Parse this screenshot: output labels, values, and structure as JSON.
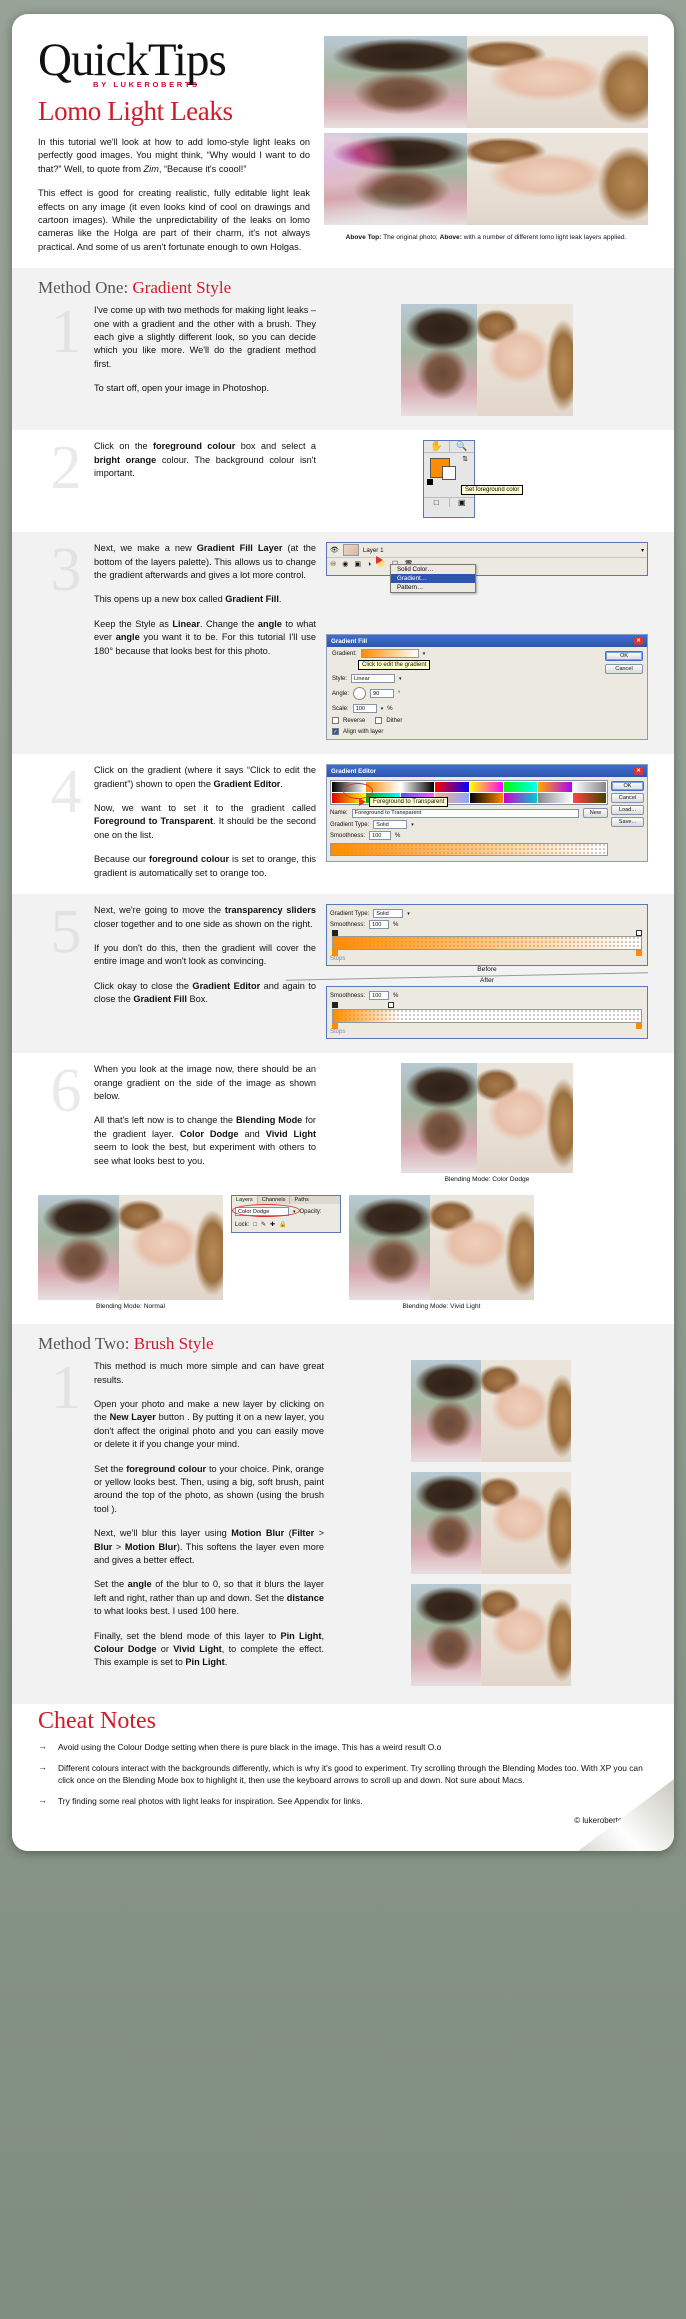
{
  "masthead": {
    "title": "QuickTips",
    "byline": "BY LUKEROBERTS",
    "subtitle": "Lomo Light Leaks"
  },
  "intro": {
    "p1": "In this tutorial we'll look at how to add lomo-style light leaks on perfectly good images. You might think, “Why would I want to do that?” Well, to quote from Zim, “Because it's coool!”",
    "p2": "This effect is good for creating realistic, fully editable light leak effects on any image (it even looks kind of cool on drawings and cartoon images). While the unpredictability of the leaks on lomo cameras like the Holga are part of their charm, it's not always practical. And some of us aren't fortunate enough to own Holgas.",
    "caption_bold_1": "Above Top:",
    "caption_mid": " The original photo; ",
    "caption_bold_2": "Above:",
    "caption_end": " with a number of different lomo light leak layers applied."
  },
  "method_one": {
    "label": "Method One:",
    "accent": "Gradient Style",
    "steps": [
      {
        "num": "1",
        "paragraphs": [
          "I've come up with two methods for making light leaks – one with a gradient and the other with a brush. They each give a slightly different look, so you can decide which you like more. We'll do the gradient method first.",
          "To start off, open your image in Photoshop."
        ]
      },
      {
        "num": "2",
        "paragraphs": [
          "Click on the foreground colour box and select a bright orange colour. The background colour isn't important."
        ],
        "tooltip": "Set foreground color"
      },
      {
        "num": "3",
        "paragraphs": [
          "Next, we make a new Gradient Fill Layer (at the bottom of the layers palette). This allows us to change the gradient afterwards and gives a lot more control.",
          "This opens up a new box called Gradient Fill.",
          "Keep the Style as Linear. Change the angle to what ever angle you want it to be. For this tutorial I'll use 180° because that looks best for this photo."
        ],
        "layer_name": "Layer 1",
        "menu_items": [
          "Solid Color…",
          "Gradient…",
          "Pattern…"
        ],
        "menu_selected": "Gradient…",
        "dialog": {
          "title": "Gradient Fill",
          "gradient_label": "Gradient:",
          "gradient_tip": "Click to edit the gradient",
          "style_label": "Style:",
          "style_value": "Linear",
          "angle_label": "Angle:",
          "angle_value": "90",
          "scale_label": "Scale:",
          "scale_value": "100",
          "scale_unit": "%",
          "reverse": "Reverse",
          "dither": "Dither",
          "align": "Align with layer",
          "ok": "OK",
          "cancel": "Cancel"
        }
      },
      {
        "num": "4",
        "paragraphs": [
          "Click on the gradient (where it says “Click to edit the gradient”) shown to open the Gradient Editor.",
          "Now, we want to set it to the gradient called Foreground to Transparent. It should be the second one on the list.",
          "Because our foreground colour is set to orange, this gradient is automatically set to orange too."
        ],
        "dialog": {
          "title": "Gradient Editor",
          "callout": "Foreground to Transparent",
          "name_label": "Name:",
          "name_value": "Foreground to Transparent",
          "new_btn": "New",
          "type_label": "Gradient Type:",
          "type_value": "Solid",
          "smooth_label": "Smoothness:",
          "smooth_value": "100",
          "smooth_unit": "%",
          "ok": "OK",
          "cancel": "Cancel",
          "load": "Load...",
          "save": "Save..."
        }
      },
      {
        "num": "5",
        "paragraphs": [
          "Next, we're going to move the transparency sliders closer together and to one side as shown on the right.",
          "If you don't do this, then the gradient will cover the entire image and won't look as convincing.",
          "Click okay to close the Gradient Editor and again to close the Gradient Fill Box."
        ],
        "before_label": "Before",
        "after_label": "After",
        "smooth_label": "Smoothness:",
        "smooth_value": "100",
        "smooth_unit": "%",
        "type_label": "Gradient Type:",
        "type_value": "Solid",
        "stops_label": "Stops"
      },
      {
        "num": "6",
        "paragraphs": [
          "When you look at the image now, there should be an orange gradient on the side of the image as shown below.",
          "All that's left now is to change the Blending Mode for the gradient layer. Color Dodge and Vivid Light seem to look the best, but experiment with others to see what looks best to you."
        ],
        "caption_dodge": "Blending Mode: Color Dodge",
        "caption_normal": "Blending Mode: Normal",
        "caption_vivid": "Blending Mode: Vivid Light",
        "palette": {
          "tab_layers": "Layers",
          "tab_channels": "Channels",
          "tab_paths": "Paths",
          "blend_value": "Color Dodge",
          "opacity_label": "Opacity:",
          "lock_label": "Lock:"
        }
      }
    ]
  },
  "method_two": {
    "label": "Method Two:",
    "accent": "Brush Style",
    "steps": [
      {
        "num": "1",
        "paragraphs": [
          "This method is much more simple and can have great results.",
          "Open your photo and make a new layer by clicking on the New Layer button . By putting it on a new layer, you don't affect the original photo and you can easily move or delete it if you change your mind.",
          "Set the foreground colour to your choice. Pink, orange or yellow looks best. Then, using a big, soft brush, paint around the top of the photo, as shown (using the brush tool ).",
          "Next, we'll blur this layer using Motion Blur (Filter > Blur > Motion Blur). This softens the layer even more and gives a better effect.",
          "Set the angle of the blur to 0, so that it blurs the layer left and right, rather than up and down. Set the distance to what looks best. I used 100 here.",
          "Finally, set the blend mode of this layer to Pin Light, Colour Dodge or Vivid Light, to complete the effect. This example is set to Pin Light."
        ]
      }
    ]
  },
  "cheat_notes": {
    "title": "Cheat Notes",
    "arrow": "→",
    "items": [
      "Avoid using the Colour Dodge setting when there is pure black in the image. This has a weird result O.o",
      "Different colours interact with the backgrounds differently, which is why it's good to experiment. Try scrolling through the Blending Modes too. With XP you can click once on the Blending Mode box to highlight it, then use the keyboard arrows to scroll up and down. Not sure about Macs.",
      "Try finding some real photos with light leaks for inspiration. See Appendix for links."
    ],
    "copyright": "© lukeroberts 2005"
  },
  "colors": {
    "accent_red": "#d11a2a",
    "orange": "#ff8c00",
    "grey_band": "#f2f2f2",
    "step_number": "#e2e2e2"
  }
}
